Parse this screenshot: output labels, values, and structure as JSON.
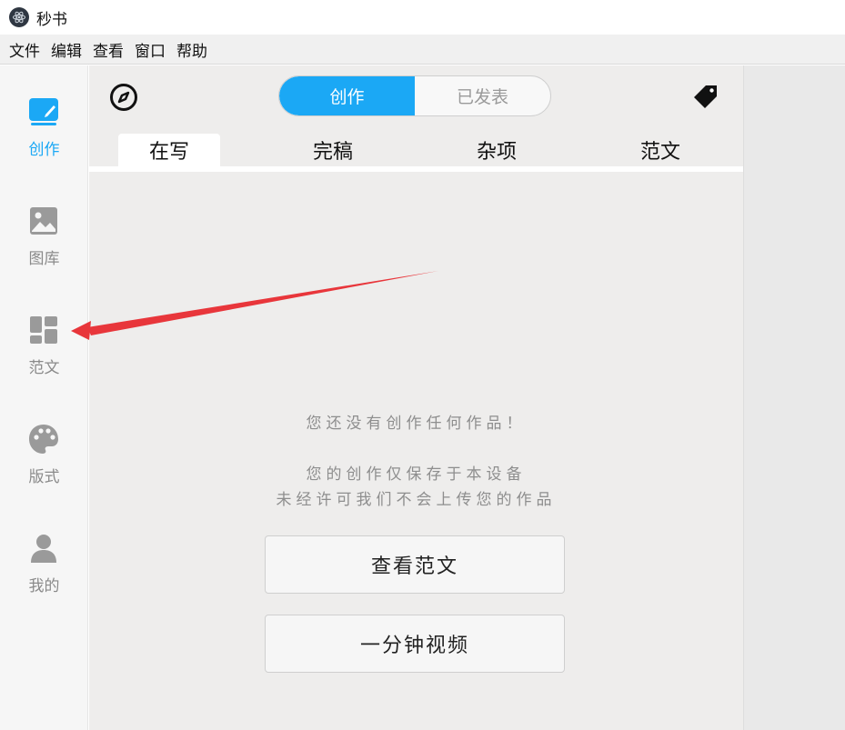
{
  "window": {
    "title": "秒书"
  },
  "menu": [
    "文件",
    "编辑",
    "查看",
    "窗口",
    "帮助"
  ],
  "sidebar": {
    "items": [
      {
        "label": "创作",
        "icon": "create-icon",
        "active": true
      },
      {
        "label": "图库",
        "icon": "gallery-icon",
        "active": false
      },
      {
        "label": "范文",
        "icon": "templates-icon",
        "active": false
      },
      {
        "label": "版式",
        "icon": "palette-icon",
        "active": false
      },
      {
        "label": "我的",
        "icon": "user-icon",
        "active": false
      }
    ]
  },
  "header": {
    "segments": [
      {
        "label": "创作",
        "active": true
      },
      {
        "label": "已发表",
        "active": false
      }
    ],
    "left_icon": "compass-icon",
    "right_icon": "tag-icon"
  },
  "subtabs": [
    {
      "label": "在写",
      "active": true
    },
    {
      "label": "完稿",
      "active": false
    },
    {
      "label": "杂项",
      "active": false
    },
    {
      "label": "范文",
      "active": false
    }
  ],
  "empty_state": {
    "line1": "您还没有创作任何作品！",
    "line2": "您的创作仅保存于本设备",
    "line3": "未经许可我们不会上传您的作品"
  },
  "actions": {
    "view_samples": "查看范文",
    "one_minute_video": "一分钟视频"
  },
  "colors": {
    "accent": "#1ba8f5",
    "annotation_arrow": "#e8363b"
  }
}
